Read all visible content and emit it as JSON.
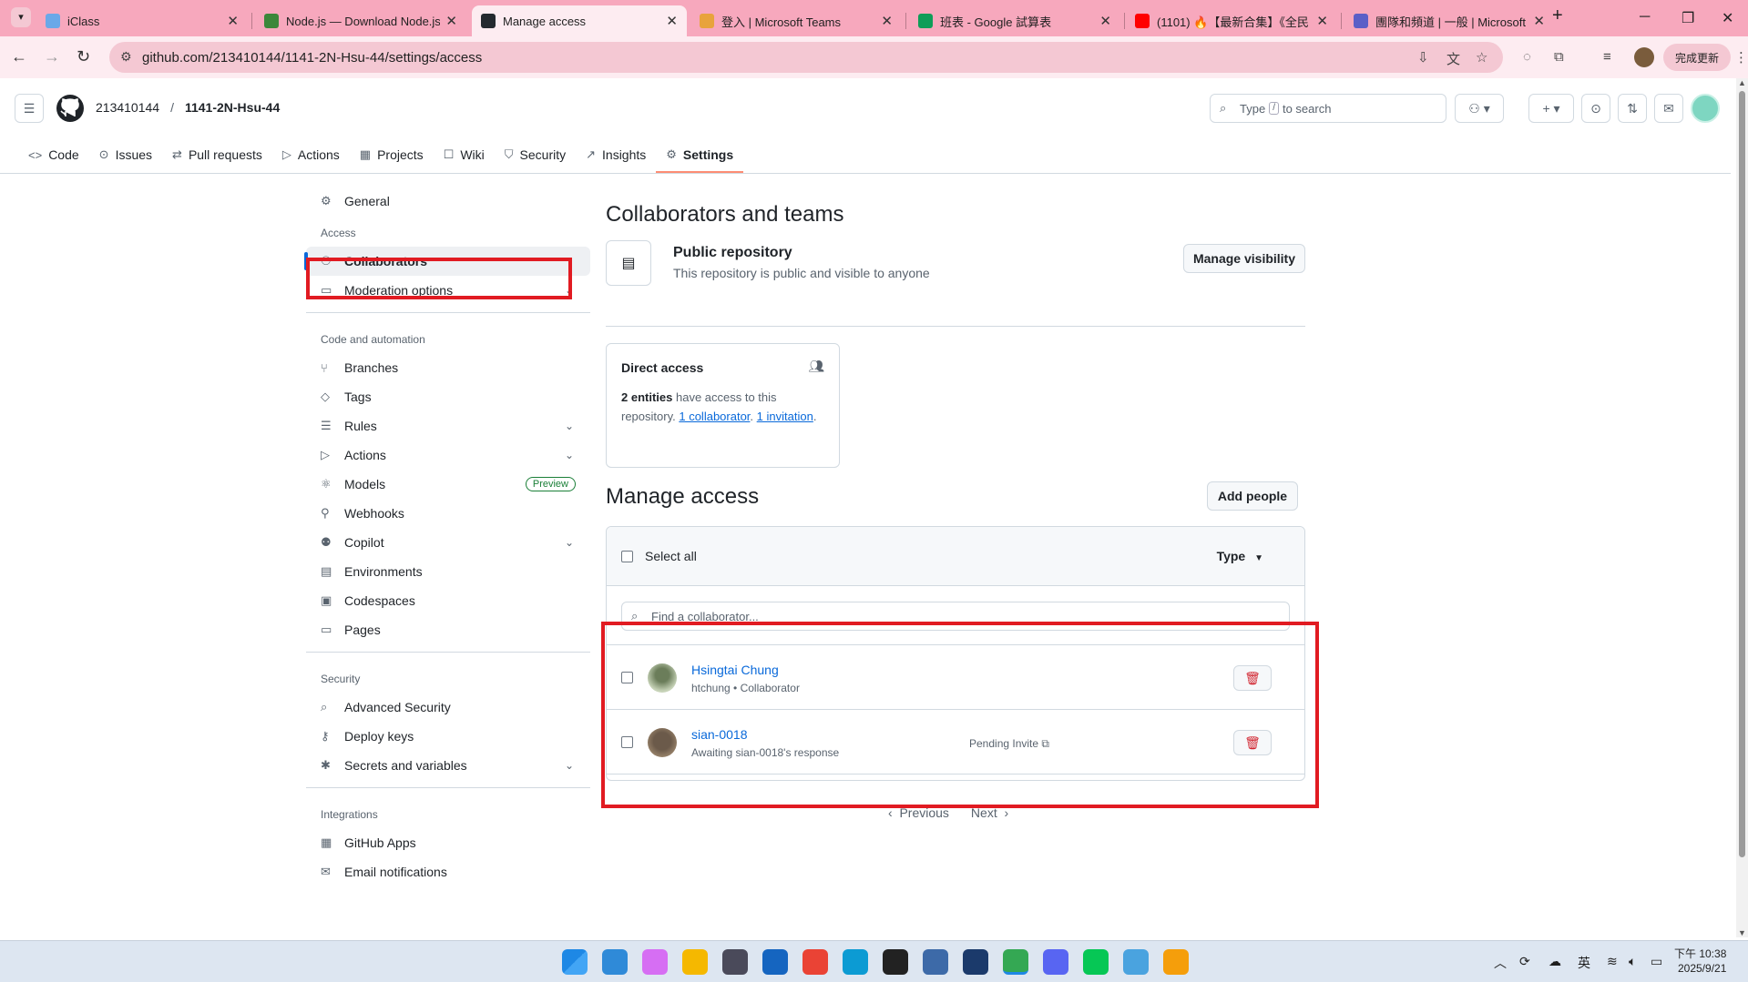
{
  "browser": {
    "tabs": [
      {
        "label": "iClass",
        "active": false
      },
      {
        "label": "Node.js — Download Node.js",
        "active": false
      },
      {
        "label": "Manage access",
        "active": true
      },
      {
        "label": "登入 | Microsoft Teams",
        "active": false
      },
      {
        "label": "班表 - Google 試算表",
        "active": false
      },
      {
        "label": "(1101) 🔥【最新合集】《全民",
        "active": false
      },
      {
        "label": "團隊和頻道 | 一般 | Microsoft T",
        "active": false
      }
    ],
    "url": "github.com/213410144/1141-2N-Hsu-44/settings/access",
    "update_label": "完成更新"
  },
  "github": {
    "owner": "213410144",
    "repo": "1141-2N-Hsu-44",
    "search_prefix": "Type",
    "search_key": "/",
    "search_suffix": "to search",
    "repo_tabs": [
      {
        "label": "Code",
        "icon": "code-icon"
      },
      {
        "label": "Issues",
        "icon": "issue-icon"
      },
      {
        "label": "Pull requests",
        "icon": "pull-request-icon"
      },
      {
        "label": "Actions",
        "icon": "play-icon"
      },
      {
        "label": "Projects",
        "icon": "table-icon"
      },
      {
        "label": "Wiki",
        "icon": "book-icon"
      },
      {
        "label": "Security",
        "icon": "shield-icon"
      },
      {
        "label": "Insights",
        "icon": "graph-icon"
      },
      {
        "label": "Settings",
        "icon": "gear-icon",
        "selected": true
      }
    ]
  },
  "sidebar": {
    "general": "General",
    "groups": [
      {
        "title": "Access",
        "items": [
          {
            "label": "Collaborators",
            "icon": "people-icon",
            "selected": true
          },
          {
            "label": "Moderation options",
            "icon": "comment-icon",
            "expandable": true
          }
        ]
      },
      {
        "title": "Code and automation",
        "items": [
          {
            "label": "Branches",
            "icon": "branch-icon"
          },
          {
            "label": "Tags",
            "icon": "tag-icon"
          },
          {
            "label": "Rules",
            "icon": "rules-icon",
            "expandable": true
          },
          {
            "label": "Actions",
            "icon": "play-icon",
            "expandable": true
          },
          {
            "label": "Models",
            "icon": "models-icon",
            "badge": "Preview"
          },
          {
            "label": "Webhooks",
            "icon": "webhook-icon"
          },
          {
            "label": "Copilot",
            "icon": "copilot-icon",
            "expandable": true
          },
          {
            "label": "Environments",
            "icon": "server-icon"
          },
          {
            "label": "Codespaces",
            "icon": "codespaces-icon"
          },
          {
            "label": "Pages",
            "icon": "browser-icon"
          }
        ]
      },
      {
        "title": "Security",
        "items": [
          {
            "label": "Advanced Security",
            "icon": "codescan-icon"
          },
          {
            "label": "Deploy keys",
            "icon": "key-icon"
          },
          {
            "label": "Secrets and variables",
            "icon": "asterisk-icon",
            "expandable": true
          }
        ]
      },
      {
        "title": "Integrations",
        "items": [
          {
            "label": "GitHub Apps",
            "icon": "apps-icon"
          },
          {
            "label": "Email notifications",
            "icon": "mail-icon"
          }
        ]
      }
    ]
  },
  "main": {
    "title": "Collaborators and teams",
    "public_title": "Public repository",
    "public_desc": "This repository is public and visible to anyone",
    "manage_visibility": "Manage visibility",
    "direct_access": {
      "title": "Direct access",
      "entities": "2 entities",
      "text1": "have access to this repository.",
      "link1": "1 collaborator",
      "dot": ".",
      "link2": "1 invitation",
      "end": "."
    },
    "manage_title": "Manage access",
    "add_people": "Add people",
    "select_all": "Select all",
    "type_filter": "Type",
    "find_placeholder": "Find a collaborator...",
    "collaborators": [
      {
        "name": "Hsingtai Chung",
        "sub": "htchung • Collaborator",
        "pending": ""
      },
      {
        "name": "sian-0018",
        "sub": "Awaiting sian-0018's response",
        "pending": "Pending Invite"
      }
    ],
    "previous": "Previous",
    "next": "Next"
  },
  "taskbar": {
    "time": "下午 10:38",
    "date": "2025/9/21",
    "ime": "英"
  }
}
